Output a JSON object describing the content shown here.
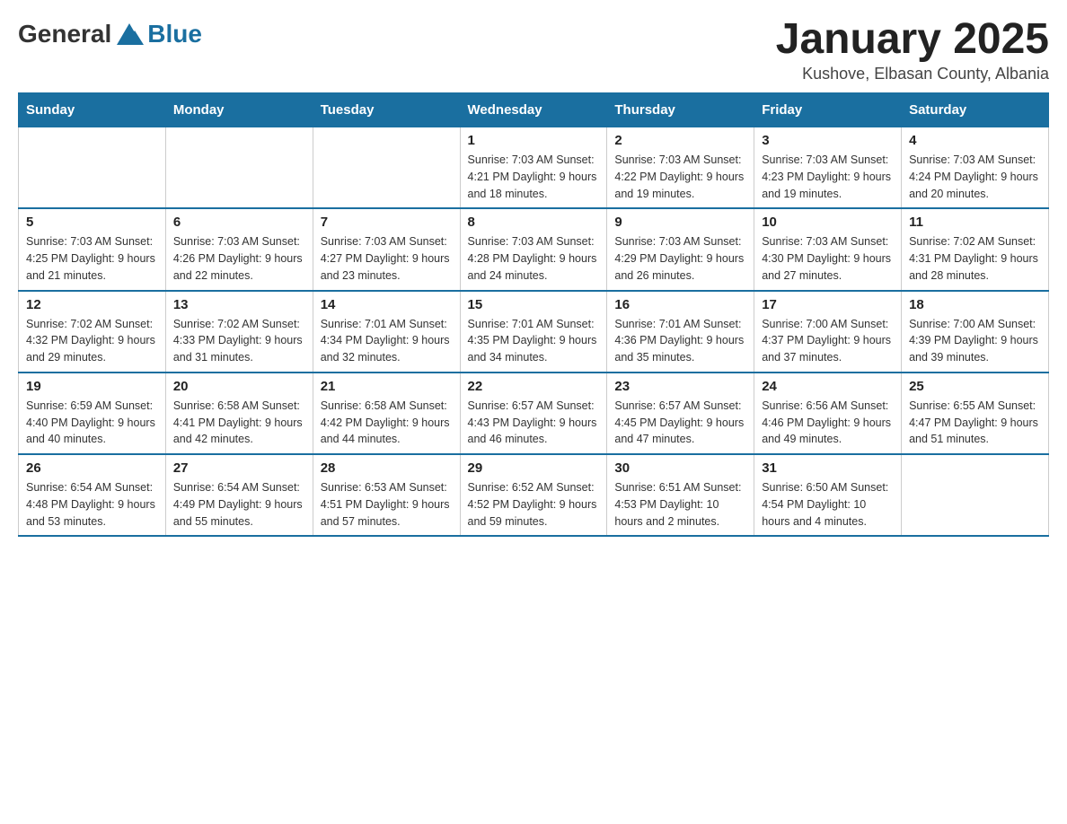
{
  "logo": {
    "general": "General",
    "blue": "Blue"
  },
  "title": "January 2025",
  "location": "Kushove, Elbasan County, Albania",
  "days_of_week": [
    "Sunday",
    "Monday",
    "Tuesday",
    "Wednesday",
    "Thursday",
    "Friday",
    "Saturday"
  ],
  "weeks": [
    [
      {
        "day": "",
        "info": ""
      },
      {
        "day": "",
        "info": ""
      },
      {
        "day": "",
        "info": ""
      },
      {
        "day": "1",
        "info": "Sunrise: 7:03 AM\nSunset: 4:21 PM\nDaylight: 9 hours\nand 18 minutes."
      },
      {
        "day": "2",
        "info": "Sunrise: 7:03 AM\nSunset: 4:22 PM\nDaylight: 9 hours\nand 19 minutes."
      },
      {
        "day": "3",
        "info": "Sunrise: 7:03 AM\nSunset: 4:23 PM\nDaylight: 9 hours\nand 19 minutes."
      },
      {
        "day": "4",
        "info": "Sunrise: 7:03 AM\nSunset: 4:24 PM\nDaylight: 9 hours\nand 20 minutes."
      }
    ],
    [
      {
        "day": "5",
        "info": "Sunrise: 7:03 AM\nSunset: 4:25 PM\nDaylight: 9 hours\nand 21 minutes."
      },
      {
        "day": "6",
        "info": "Sunrise: 7:03 AM\nSunset: 4:26 PM\nDaylight: 9 hours\nand 22 minutes."
      },
      {
        "day": "7",
        "info": "Sunrise: 7:03 AM\nSunset: 4:27 PM\nDaylight: 9 hours\nand 23 minutes."
      },
      {
        "day": "8",
        "info": "Sunrise: 7:03 AM\nSunset: 4:28 PM\nDaylight: 9 hours\nand 24 minutes."
      },
      {
        "day": "9",
        "info": "Sunrise: 7:03 AM\nSunset: 4:29 PM\nDaylight: 9 hours\nand 26 minutes."
      },
      {
        "day": "10",
        "info": "Sunrise: 7:03 AM\nSunset: 4:30 PM\nDaylight: 9 hours\nand 27 minutes."
      },
      {
        "day": "11",
        "info": "Sunrise: 7:02 AM\nSunset: 4:31 PM\nDaylight: 9 hours\nand 28 minutes."
      }
    ],
    [
      {
        "day": "12",
        "info": "Sunrise: 7:02 AM\nSunset: 4:32 PM\nDaylight: 9 hours\nand 29 minutes."
      },
      {
        "day": "13",
        "info": "Sunrise: 7:02 AM\nSunset: 4:33 PM\nDaylight: 9 hours\nand 31 minutes."
      },
      {
        "day": "14",
        "info": "Sunrise: 7:01 AM\nSunset: 4:34 PM\nDaylight: 9 hours\nand 32 minutes."
      },
      {
        "day": "15",
        "info": "Sunrise: 7:01 AM\nSunset: 4:35 PM\nDaylight: 9 hours\nand 34 minutes."
      },
      {
        "day": "16",
        "info": "Sunrise: 7:01 AM\nSunset: 4:36 PM\nDaylight: 9 hours\nand 35 minutes."
      },
      {
        "day": "17",
        "info": "Sunrise: 7:00 AM\nSunset: 4:37 PM\nDaylight: 9 hours\nand 37 minutes."
      },
      {
        "day": "18",
        "info": "Sunrise: 7:00 AM\nSunset: 4:39 PM\nDaylight: 9 hours\nand 39 minutes."
      }
    ],
    [
      {
        "day": "19",
        "info": "Sunrise: 6:59 AM\nSunset: 4:40 PM\nDaylight: 9 hours\nand 40 minutes."
      },
      {
        "day": "20",
        "info": "Sunrise: 6:58 AM\nSunset: 4:41 PM\nDaylight: 9 hours\nand 42 minutes."
      },
      {
        "day": "21",
        "info": "Sunrise: 6:58 AM\nSunset: 4:42 PM\nDaylight: 9 hours\nand 44 minutes."
      },
      {
        "day": "22",
        "info": "Sunrise: 6:57 AM\nSunset: 4:43 PM\nDaylight: 9 hours\nand 46 minutes."
      },
      {
        "day": "23",
        "info": "Sunrise: 6:57 AM\nSunset: 4:45 PM\nDaylight: 9 hours\nand 47 minutes."
      },
      {
        "day": "24",
        "info": "Sunrise: 6:56 AM\nSunset: 4:46 PM\nDaylight: 9 hours\nand 49 minutes."
      },
      {
        "day": "25",
        "info": "Sunrise: 6:55 AM\nSunset: 4:47 PM\nDaylight: 9 hours\nand 51 minutes."
      }
    ],
    [
      {
        "day": "26",
        "info": "Sunrise: 6:54 AM\nSunset: 4:48 PM\nDaylight: 9 hours\nand 53 minutes."
      },
      {
        "day": "27",
        "info": "Sunrise: 6:54 AM\nSunset: 4:49 PM\nDaylight: 9 hours\nand 55 minutes."
      },
      {
        "day": "28",
        "info": "Sunrise: 6:53 AM\nSunset: 4:51 PM\nDaylight: 9 hours\nand 57 minutes."
      },
      {
        "day": "29",
        "info": "Sunrise: 6:52 AM\nSunset: 4:52 PM\nDaylight: 9 hours\nand 59 minutes."
      },
      {
        "day": "30",
        "info": "Sunrise: 6:51 AM\nSunset: 4:53 PM\nDaylight: 10 hours\nand 2 minutes."
      },
      {
        "day": "31",
        "info": "Sunrise: 6:50 AM\nSunset: 4:54 PM\nDaylight: 10 hours\nand 4 minutes."
      },
      {
        "day": "",
        "info": ""
      }
    ]
  ]
}
